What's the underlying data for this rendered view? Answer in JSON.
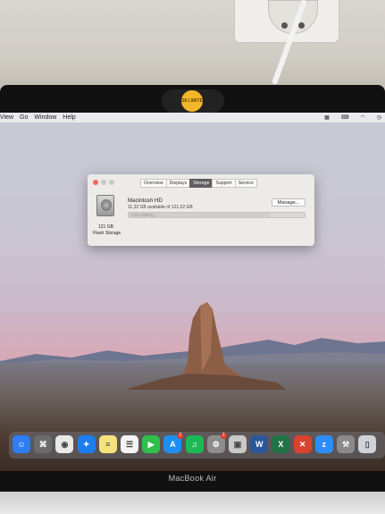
{
  "camera_cover_text": "S8 LIMITE",
  "menubar": {
    "items": [
      "View",
      "Go",
      "Window",
      "Help"
    ],
    "status_icons": [
      "keyboard-icon",
      "input-source-icon",
      "wifi-icon",
      "time-machine-icon"
    ]
  },
  "about_window": {
    "tabs": [
      "Overview",
      "Displays",
      "Storage",
      "Support",
      "Service"
    ],
    "active_tab": "Storage",
    "disk_name": "Macintosh HD",
    "disk_available": "11,32 GB available of 121,02 GB",
    "disk_size": "121 GB",
    "disk_type": "Flash Storage",
    "manage_label": "Manage...",
    "bar_label": "Calculating...",
    "used_fraction": 0.8
  },
  "dock": {
    "apps": [
      {
        "name": "finder-icon",
        "color": "#2e7cf6"
      },
      {
        "name": "launchpad-icon",
        "color": "#6b6b6b"
      },
      {
        "name": "chrome-icon",
        "color": "#e8e8e8"
      },
      {
        "name": "safari-icon",
        "color": "#1b7ef0"
      },
      {
        "name": "notes-icon",
        "color": "#f6e27c"
      },
      {
        "name": "reminders-icon",
        "color": "#f4f4f4"
      },
      {
        "name": "facetime-icon",
        "color": "#2fbf4a"
      },
      {
        "name": "app-store-icon",
        "color": "#1f8ef1"
      },
      {
        "name": "spotify-icon",
        "color": "#1db954"
      },
      {
        "name": "system-preferences-icon",
        "color": "#8d8d8d"
      },
      {
        "name": "preview-icon",
        "color": "#c9c9c9"
      },
      {
        "name": "word-icon",
        "color": "#2b579a"
      },
      {
        "name": "excel-icon",
        "color": "#217346"
      },
      {
        "name": "remote-desktop-icon",
        "color": "#d9432f"
      },
      {
        "name": "zoom-icon",
        "color": "#2d8cff"
      },
      {
        "name": "utilities-icon",
        "color": "#8a8a8a"
      },
      {
        "name": "trash-icon",
        "color": "#cfd3d8"
      }
    ],
    "badges": {
      "app-store-icon": "2",
      "system-preferences-icon": "1"
    }
  },
  "laptop_brand": "MacBook Air"
}
